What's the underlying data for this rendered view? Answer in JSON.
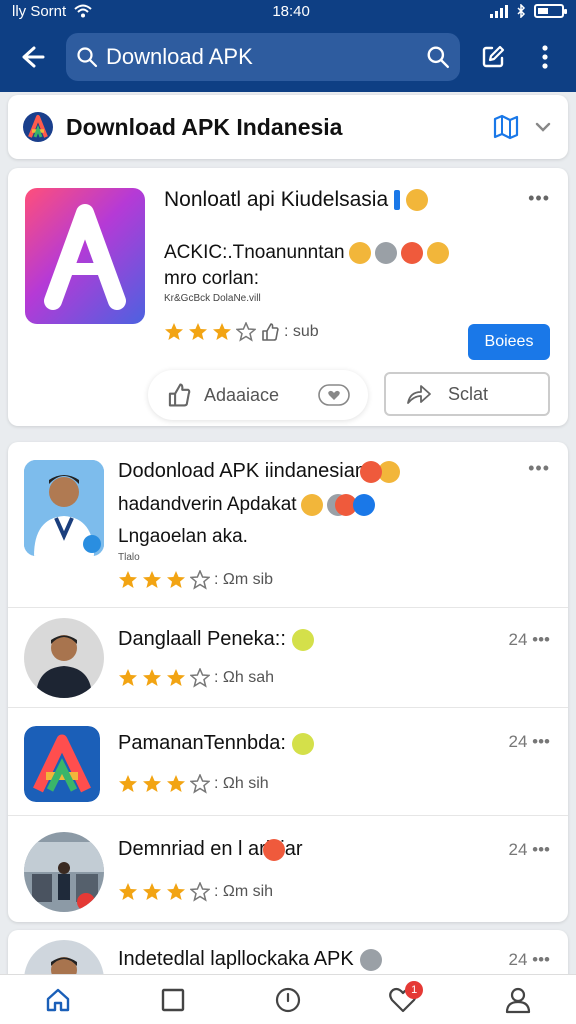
{
  "status": {
    "carrier": "lly Sornt",
    "time": "18:40"
  },
  "search": {
    "query": "Download APK"
  },
  "header": {
    "title": "Download APK Indanesia"
  },
  "featured": {
    "name": "Nonloatl api Kiudelsasia",
    "desc_line1": "ACKIC:.Tnoanunntan",
    "desc_line2": "mro corlan:",
    "tiny": "Kr&GcBck DolaNe.vill",
    "rating_text": ": sub",
    "install_label": "Boiees",
    "like_label": "Adaaiace",
    "share_label": "Sclat"
  },
  "list": [
    {
      "title": "Dodonload APK  iindanesiam",
      "sub1": "hadandverin Apdakat",
      "sub2": "Lngaoelan aka.",
      "tiny": "Tlalo",
      "rating_text": ":  Ωm sib"
    },
    {
      "title": "Danglaall Peneka::",
      "time": "24",
      "rating_text": ":  Ωh sah"
    },
    {
      "title": "PamananTennbda:",
      "time": "24",
      "rating_text": ":  Ωh sih"
    },
    {
      "title": "Demnriad en l arisiar",
      "time": "24",
      "rating_text": ":  Ωm sih"
    }
  ],
  "peek": {
    "title": "Indetedlal lapllockaka APK",
    "time": "24"
  },
  "nav": {
    "badge": "1"
  },
  "colors": {
    "primary": "#0e3f84",
    "accent": "#1a78e8",
    "star": "#f2a413"
  }
}
